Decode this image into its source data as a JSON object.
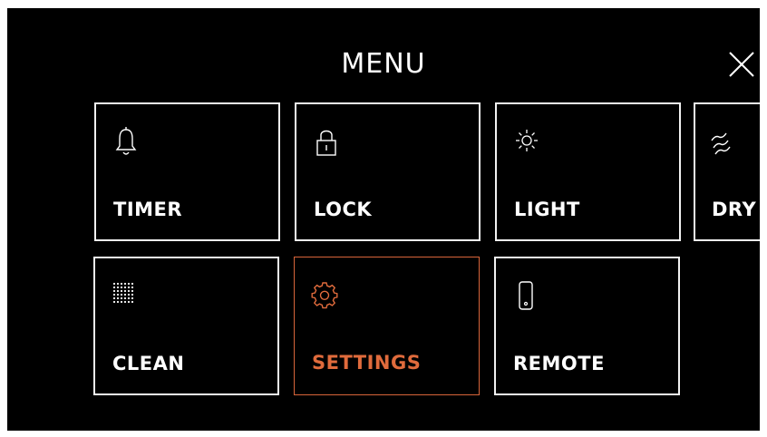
{
  "menu": {
    "title": "MENU",
    "close_icon": "close-icon"
  },
  "tiles": [
    {
      "label": "TIMER",
      "icon": "bell-icon",
      "active": false
    },
    {
      "label": "LOCK",
      "icon": "lock-icon",
      "active": false
    },
    {
      "label": "LIGHT",
      "icon": "sun-icon",
      "active": false
    },
    {
      "label": "DRY",
      "icon": "heat-waves-icon",
      "active": false
    },
    {
      "label": "CLEAN",
      "icon": "dot-grid-icon",
      "active": false
    },
    {
      "label": "SETTINGS",
      "icon": "gear-icon",
      "active": true
    },
    {
      "label": "REMOTE",
      "icon": "phone-icon",
      "active": false
    }
  ],
  "colors": {
    "background": "#000000",
    "foreground": "#ffffff",
    "accent": "#e06b3c"
  }
}
